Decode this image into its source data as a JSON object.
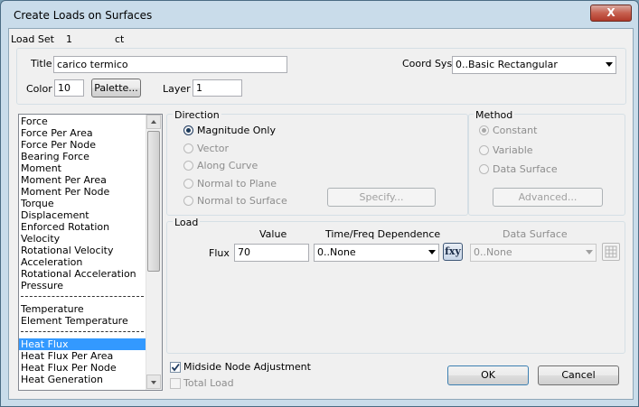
{
  "window": {
    "title": "Create Loads on Surfaces",
    "close_label": "X"
  },
  "load_set": {
    "label": "Load Set",
    "id": "1",
    "name": "ct"
  },
  "title_field": {
    "label": "Title",
    "value": "carico termico"
  },
  "coord_sys": {
    "label": "Coord Sys",
    "value": "0..Basic Rectangular"
  },
  "color": {
    "label": "Color",
    "value": "10",
    "palette_label": "Palette..."
  },
  "layer": {
    "label": "Layer",
    "value": "1"
  },
  "load_types": {
    "items": [
      "Force",
      "Force Per Area",
      "Force Per Node",
      "Bearing Force",
      "Moment",
      "Moment Per Area",
      "Moment Per Node",
      "Torque",
      "Displacement",
      "Enforced Rotation",
      "Velocity",
      "Rotational Velocity",
      "Acceleration",
      "Rotational Acceleration",
      "Pressure"
    ],
    "thermal_items": [
      "Temperature",
      "Element Temperature"
    ],
    "heat_items": [
      "Heat Flux",
      "Heat Flux Per Area",
      "Heat Flux Per Node",
      "Heat Generation"
    ],
    "selected": "Heat Flux"
  },
  "direction": {
    "label": "Direction",
    "options": [
      "Magnitude Only",
      "Vector",
      "Along Curve",
      "Normal to Plane",
      "Normal to Surface"
    ],
    "selected": "Magnitude Only",
    "specify_label": "Specify..."
  },
  "method": {
    "label": "Method",
    "options": [
      "Constant",
      "Variable",
      "Data Surface"
    ],
    "selected": "Constant",
    "advanced_label": "Advanced..."
  },
  "load": {
    "label": "Load",
    "value_header": "Value",
    "time_header": "Time/Freq Dependence",
    "data_surface_header": "Data Surface",
    "row_label": "Flux",
    "value": "70",
    "time_dependence": "0..None",
    "fxy_label": "fxy",
    "data_surface": "0..None"
  },
  "options": {
    "midside_label": "Midside Node Adjustment",
    "midside_checked": true,
    "total_label": "Total Load",
    "total_checked": false
  },
  "buttons": {
    "ok": "OK",
    "cancel": "Cancel"
  }
}
